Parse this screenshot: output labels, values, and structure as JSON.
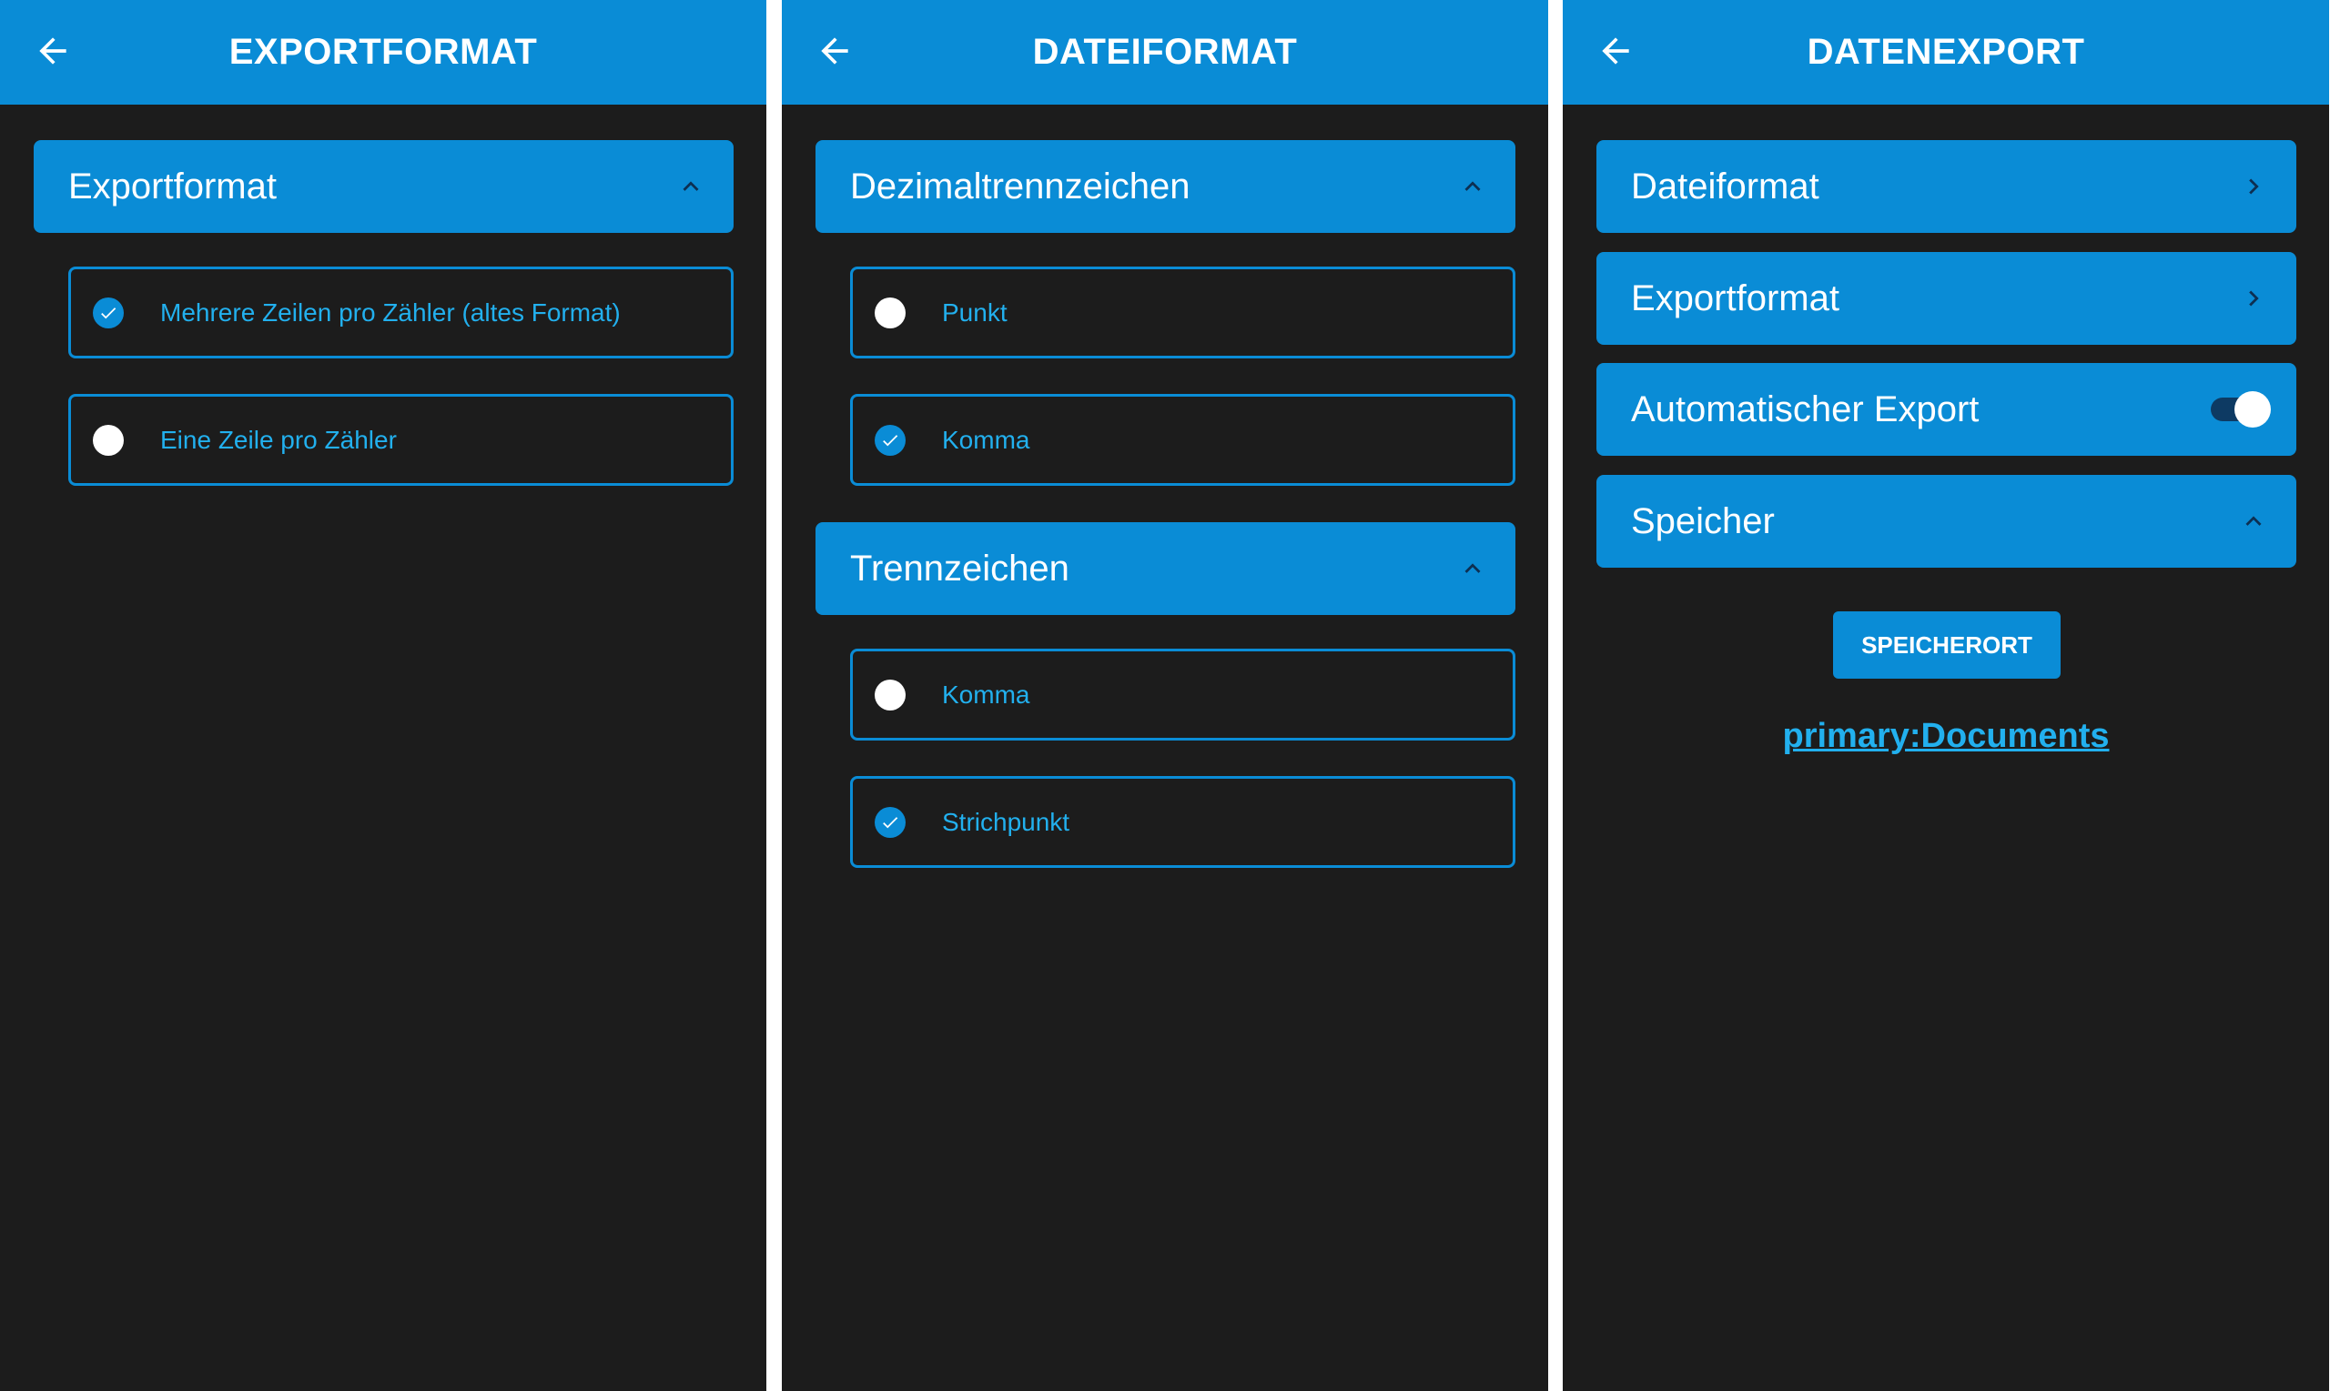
{
  "colors": {
    "accent": "#0a8cd6",
    "option_text": "#22b0ee",
    "background": "#1c1c1c"
  },
  "screens": [
    {
      "title": "EXPORTFORMAT",
      "sections": [
        {
          "label": "Exportformat",
          "icon": "chevron-up-icon",
          "options": [
            {
              "label": "Mehrere Zeilen pro Zähler (altes Format)",
              "selected": true
            },
            {
              "label": "Eine Zeile pro Zähler",
              "selected": false
            }
          ]
        }
      ]
    },
    {
      "title": "DATEIFORMAT",
      "sections": [
        {
          "label": "Dezimaltrennzeichen",
          "icon": "chevron-up-icon",
          "options": [
            {
              "label": "Punkt",
              "selected": false
            },
            {
              "label": "Komma",
              "selected": true
            }
          ]
        },
        {
          "label": "Trennzeichen",
          "icon": "chevron-up-icon",
          "options": [
            {
              "label": "Komma",
              "selected": false
            },
            {
              "label": "Strichpunkt",
              "selected": true
            }
          ]
        }
      ]
    },
    {
      "title": "DATENEXPORT",
      "items": [
        {
          "label": "Dateiformat",
          "icon": "chevron-right-icon"
        },
        {
          "label": "Exportformat",
          "icon": "chevron-right-icon"
        },
        {
          "label": "Automatischer Export",
          "toggle_on": true
        },
        {
          "label": "Speicher",
          "icon": "chevron-up-icon"
        }
      ],
      "storage_button": "SPEICHERORT",
      "storage_path": "primary:Documents"
    }
  ]
}
